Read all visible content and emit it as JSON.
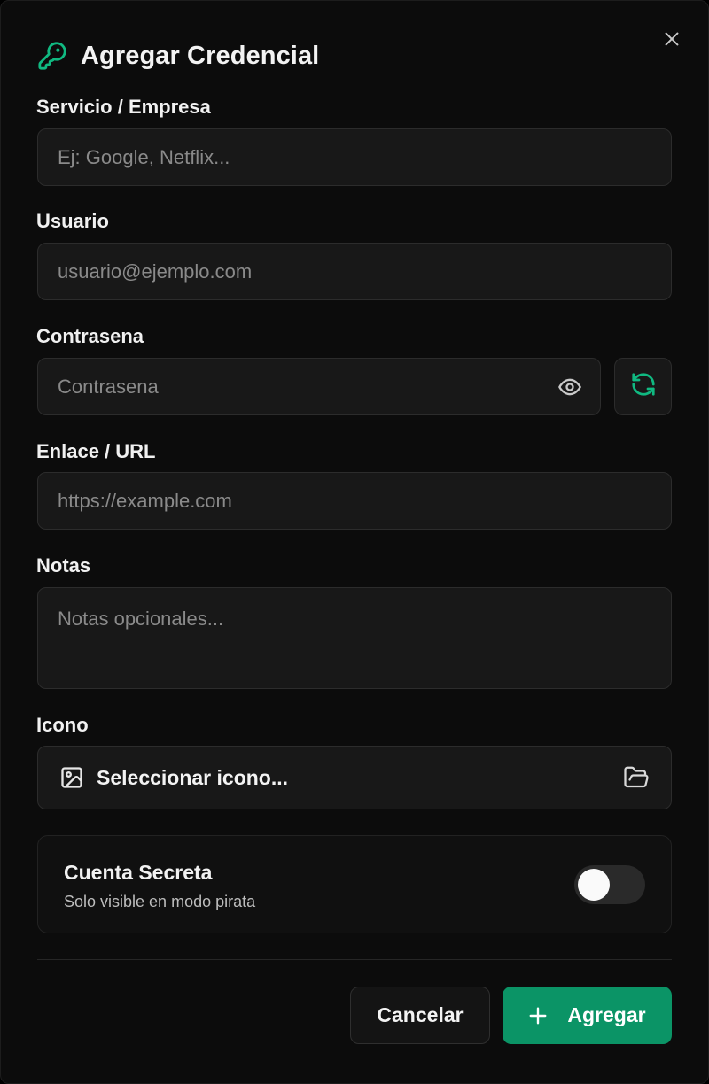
{
  "dialog": {
    "title": "Agregar Credencial",
    "accent_color": "#10b981",
    "icons": {
      "title": "key-icon",
      "close": "close-icon"
    }
  },
  "form": {
    "service": {
      "label": "Servicio / Empresa",
      "placeholder": "Ej: Google, Netflix..."
    },
    "user": {
      "label": "Usuario",
      "placeholder": "usuario@ejemplo.com"
    },
    "password": {
      "label": "Contrasena",
      "placeholder": "Contrasena",
      "icons": [
        "eye-icon",
        "refresh-icon"
      ]
    },
    "url": {
      "label": "Enlace / URL",
      "placeholder": "https://example.com"
    },
    "notes": {
      "label": "Notas",
      "placeholder": "Notas opcionales..."
    },
    "icon": {
      "label": "Icono",
      "select_label": "Seleccionar icono...",
      "icons": [
        "image-icon",
        "folder-icon"
      ]
    }
  },
  "secret": {
    "title": "Cuenta Secreta",
    "subtitle": "Solo visible en modo pirata",
    "enabled": false
  },
  "actions": {
    "cancel": "Cancelar",
    "add": "Agregar",
    "add_color": "#0b9466"
  }
}
